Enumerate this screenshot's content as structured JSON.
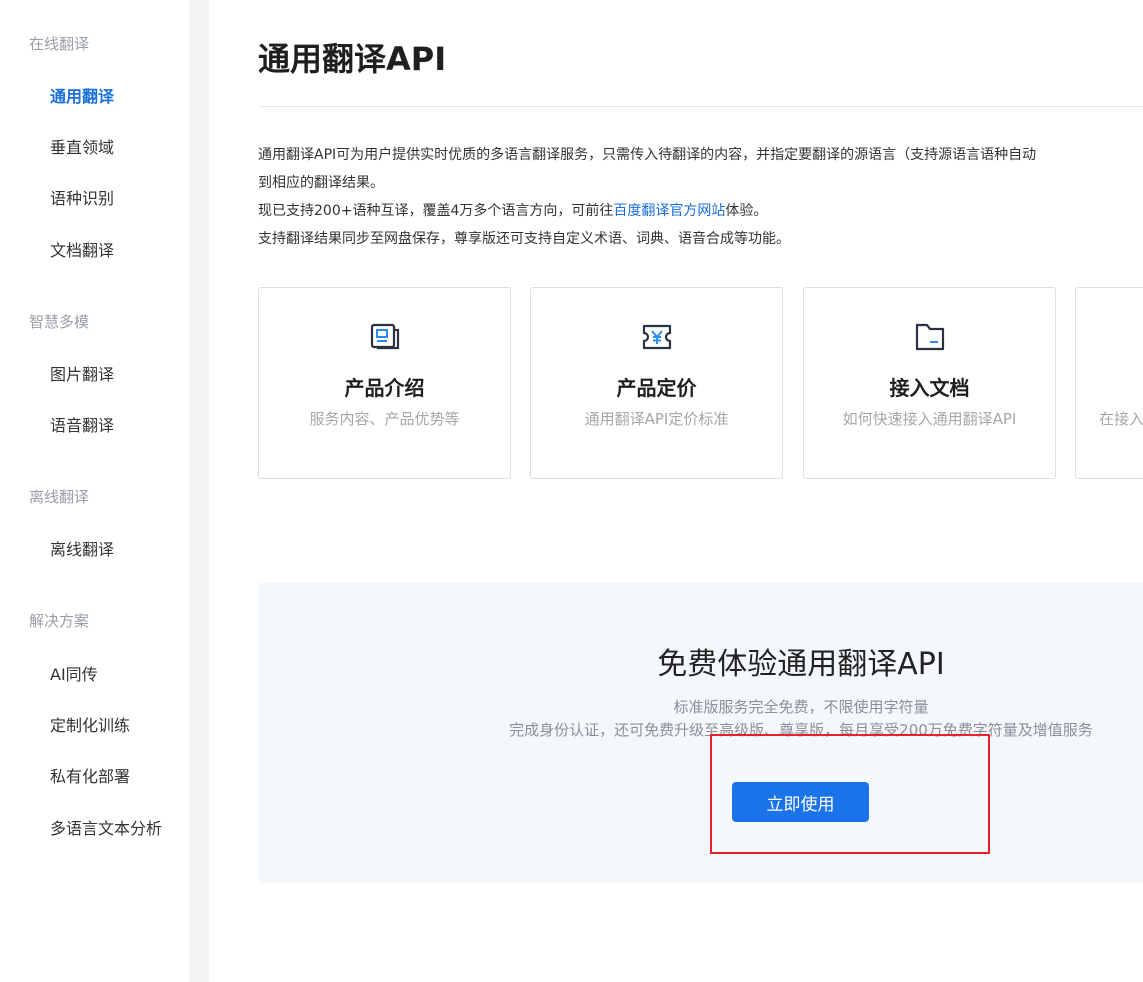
{
  "sidebar": {
    "groups": [
      {
        "title": "在线翻译",
        "items": [
          {
            "label": "通用翻译",
            "active": true
          },
          {
            "label": "垂直领域"
          },
          {
            "label": "语种识别"
          },
          {
            "label": "文档翻译"
          }
        ]
      },
      {
        "title": "智慧多模",
        "items": [
          {
            "label": "图片翻译"
          },
          {
            "label": "语音翻译"
          }
        ]
      },
      {
        "title": "离线翻译",
        "items": [
          {
            "label": "离线翻译"
          }
        ]
      },
      {
        "title": "解决方案",
        "items": [
          {
            "label": "AI同传"
          },
          {
            "label": "定制化训练"
          },
          {
            "label": "私有化部署"
          },
          {
            "label": "多语言文本分析"
          }
        ]
      }
    ]
  },
  "main": {
    "title": "通用翻译API",
    "description": {
      "line1": "通用翻译API可为用户提供实时优质的多语言翻译服务，只需传入待翻译的内容，并指定要翻译的源语言（支持源语言语种自动",
      "line2": "到相应的翻译结果。",
      "line3_before": "现已支持200+语种互译，覆盖4万多个语言方向，可前往",
      "line3_link": "百度翻译官方网站",
      "line3_after": "体验。",
      "line4": "支持翻译结果同步至网盘保存，尊享版还可支持自定义术语、词典、语音合成等功能。"
    },
    "cards": [
      {
        "title": "产品介绍",
        "subtitle": "服务内容、产品优势等",
        "icon": "product-intro-icon"
      },
      {
        "title": "产品定价",
        "subtitle": "通用翻译API定价标准",
        "icon": "pricing-icon"
      },
      {
        "title": "接入文档",
        "subtitle": "如何快速接入通用翻译API",
        "icon": "folder-icon"
      },
      {
        "title": "",
        "subtitle": "在接入",
        "icon": ""
      }
    ],
    "promo": {
      "title": "免费体验通用翻译API",
      "line1": "标准版服务完全免费，不限使用字符量",
      "line2": "完成身份认证，还可免费升级至高级版、尊享版，每月享受200万免费字符量及增值服务",
      "button": "立即使用"
    }
  },
  "colors": {
    "accent": "#1a6fd8",
    "button": "#1a73e8",
    "highlight": "#e8212d"
  }
}
